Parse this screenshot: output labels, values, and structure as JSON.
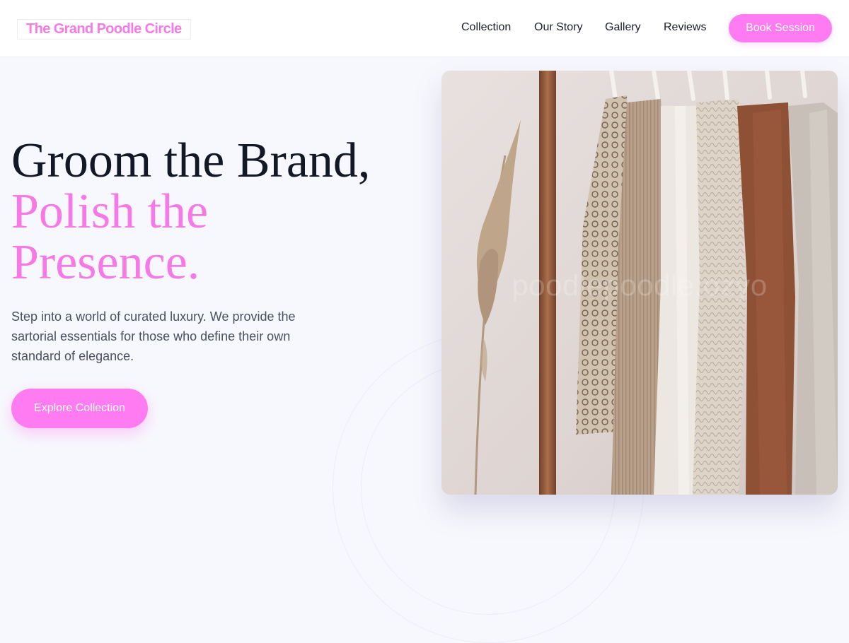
{
  "header": {
    "logo": "The Grand Poodle Circle",
    "nav": {
      "collection": "Collection",
      "our_story": "Our Story",
      "gallery": "Gallery",
      "reviews": "Reviews"
    },
    "cta": "Book Session"
  },
  "hero": {
    "headline_line1": "Groom the Brand,",
    "headline_line2": "Polish the",
    "headline_line3": "Presence.",
    "subtitle": "Step into a world of curated luxury. We provide the sartorial essentials for those who define their own standard of elegance.",
    "cta": "Explore Collection",
    "image_watermark": "poodlepoodle.ozyo"
  },
  "colors": {
    "accent": "#ff7bf2",
    "accent_text": "#f57ae6",
    "heading": "#131827",
    "body_text": "#4a5060",
    "background": "#f7f8fd"
  }
}
